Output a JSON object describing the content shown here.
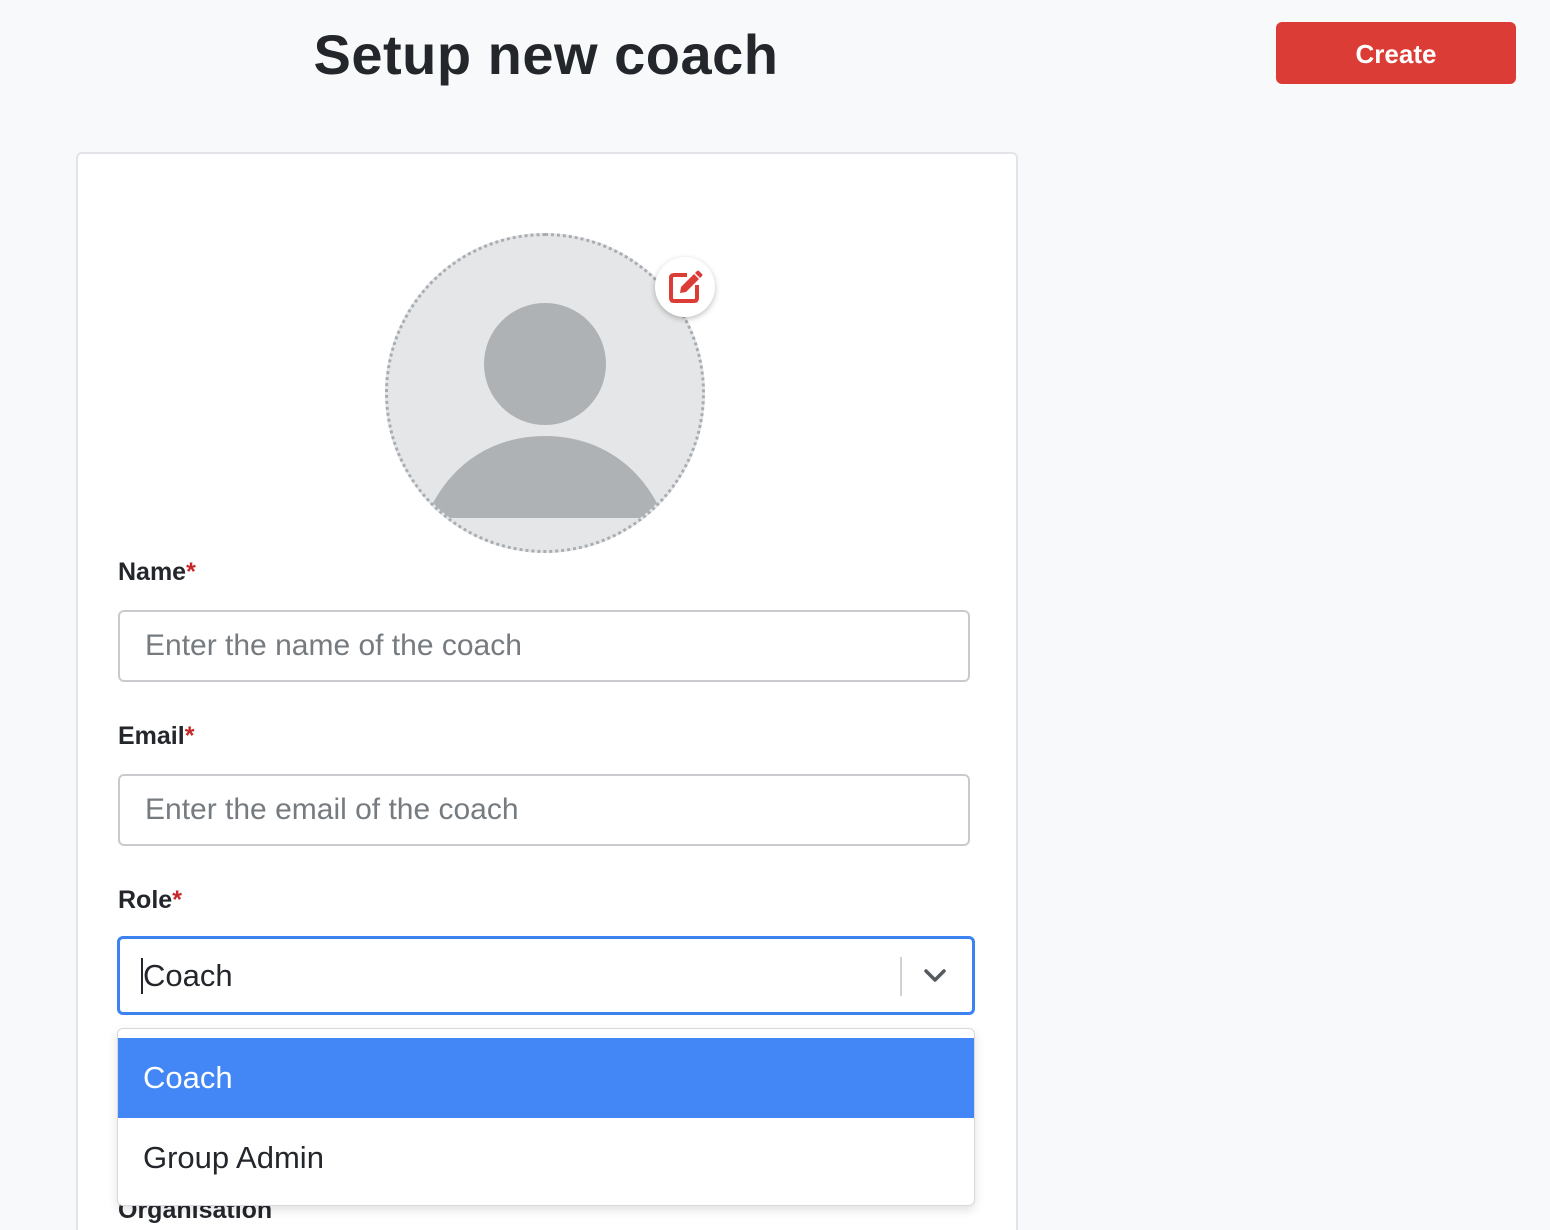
{
  "header": {
    "title": "Setup new coach",
    "create_label": "Create"
  },
  "colors": {
    "accent_red": "#db3c36",
    "focus_blue": "#3c82f0",
    "selected_option_blue": "#4287f5"
  },
  "avatar": {
    "icon": "user-placeholder-icon",
    "edit_icon": "edit-icon"
  },
  "form": {
    "name": {
      "label": "Name",
      "required_mark": "*",
      "value": "",
      "placeholder": "Enter the name of the coach"
    },
    "email": {
      "label": "Email",
      "required_mark": "*",
      "value": "",
      "placeholder": "Enter the email of the coach"
    },
    "role": {
      "label": "Role",
      "required_mark": "*",
      "value": "Coach",
      "dropdown_icon": "chevron-down-icon",
      "options": [
        "Coach",
        "Group Admin"
      ],
      "selected_option": "Coach"
    },
    "organisation": {
      "label": "Organisation"
    }
  }
}
